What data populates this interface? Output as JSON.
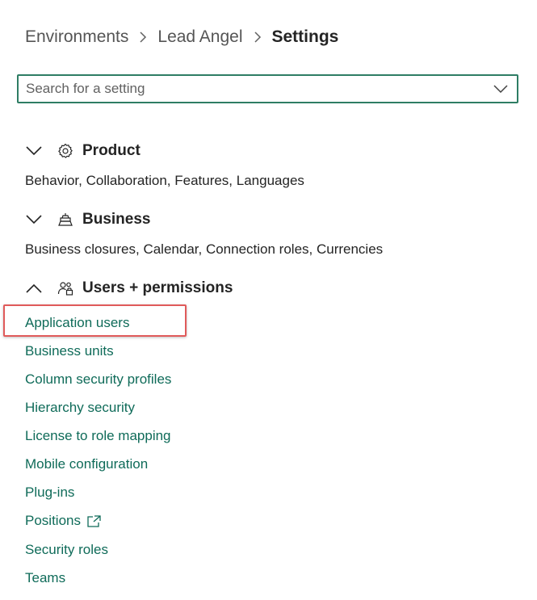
{
  "breadcrumb": {
    "items": [
      "Environments",
      "Lead Angel"
    ],
    "current": "Settings"
  },
  "search": {
    "placeholder": "Search for a setting",
    "value": ""
  },
  "sections": {
    "product": {
      "title": "Product",
      "icon": "gear-icon",
      "expanded": false,
      "summary": "Behavior, Collaboration, Features, Languages"
    },
    "business": {
      "title": "Business",
      "icon": "cake-icon",
      "expanded": false,
      "summary": "Business closures, Calendar, Connection roles, Currencies"
    },
    "users_permissions": {
      "title": "Users + permissions",
      "icon": "people-lock-icon",
      "expanded": true,
      "links": [
        "Application users",
        "Business units",
        "Column security profiles",
        "Hierarchy security",
        "License to role mapping",
        "Mobile configuration",
        "Plug-ins",
        "Positions",
        "Security roles",
        "Teams"
      ]
    }
  },
  "colors": {
    "accent": "#2e7d64",
    "link": "#0f6b59",
    "highlight": "#e05a5a",
    "text": "#242424"
  }
}
